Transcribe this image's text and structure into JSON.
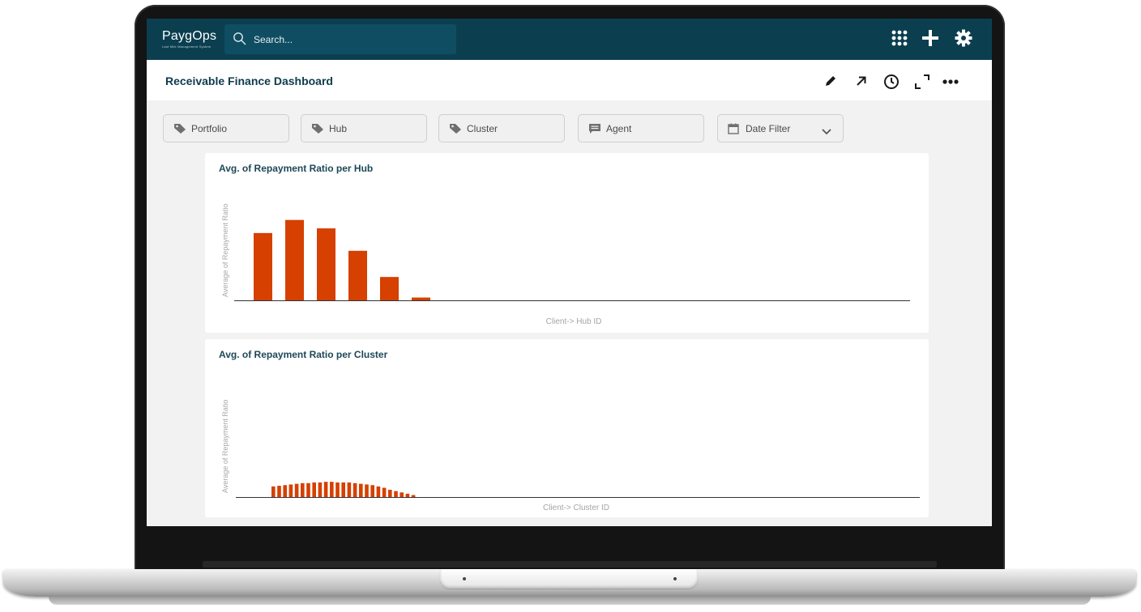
{
  "app": {
    "logo_name": "PaygOps",
    "logo_tagline": "Last Mile Management System",
    "search_placeholder": "Search..."
  },
  "header": {
    "title": "Receivable Finance Dashboard"
  },
  "filters": [
    {
      "label": "Portfolio",
      "icon": "tag-icon"
    },
    {
      "label": "Hub",
      "icon": "tag-icon"
    },
    {
      "label": "Cluster",
      "icon": "tag-icon"
    },
    {
      "label": "Agent",
      "icon": "comment-icon"
    },
    {
      "label": "Date Filter",
      "icon": "calendar-icon"
    }
  ],
  "colors": {
    "topbar": "#0b3f50",
    "bar": "#d64000",
    "title": "#0e3b4d"
  },
  "chart_data": [
    {
      "type": "bar",
      "title": "Avg. of Repayment Ratio per Hub",
      "xlabel": "Client-> Hub ID",
      "ylabel": "Average of Repayment Ratio",
      "values": [
        0.72,
        0.86,
        0.77,
        0.53,
        0.25,
        0.03
      ],
      "ylim": [
        0,
        1.1
      ],
      "grid": false,
      "legend": "none"
    },
    {
      "type": "bar",
      "title": "Avg. of Repayment Ratio per Cluster",
      "xlabel": "Client-> Cluster ID",
      "ylabel": "Average of Repayment Ratio",
      "values": [
        0.16,
        0.17,
        0.18,
        0.19,
        0.2,
        0.21,
        0.21,
        0.22,
        0.22,
        0.23,
        0.23,
        0.22,
        0.22,
        0.22,
        0.21,
        0.2,
        0.19,
        0.18,
        0.16,
        0.14,
        0.11,
        0.09,
        0.07,
        0.05,
        0.03
      ],
      "ylim": [
        0,
        1.1
      ],
      "grid": false,
      "legend": "none"
    }
  ]
}
